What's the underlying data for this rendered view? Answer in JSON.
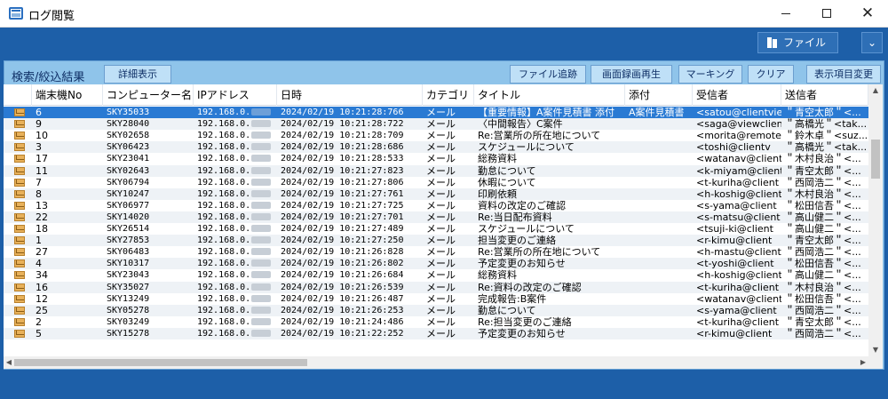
{
  "window": {
    "title": "ログ閲覧"
  },
  "toolbar": {
    "file_label": "ファイル",
    "dropdown_glyph": "⌄"
  },
  "panel": {
    "title": "検索/絞込結果",
    "buttons": {
      "detail": "詳細表示",
      "file_trace": "ファイル追跡",
      "screen_record": "画面録画再生",
      "marking": "マーキング",
      "clear": "クリア",
      "columns": "表示項目変更"
    }
  },
  "table": {
    "headers": [
      "端末機No",
      "コンピューター名",
      "IPアドレス",
      "日時",
      "カテゴリ",
      "タイトル",
      "添付",
      "受信者",
      "送信者"
    ],
    "ip_prefix": "192.168.0.",
    "rows": [
      {
        "no": "6",
        "pc": "SKY35033",
        "dt": "2024/02/19 10:21:28:766",
        "cat": "メール",
        "title": "【重要情報】A案件見積書 添付",
        "att": "A案件見積書",
        "to": "<satou@clientvie...",
        "from": "＂青空太郎＂<..."
      },
      {
        "no": "9",
        "pc": "SKY28040",
        "dt": "2024/02/19 10:21:28:722",
        "cat": "メール",
        "title": "〈中間報告〉C案件",
        "att": "",
        "to": "<saga@viewclient...",
        "from": "＂高橋光＂<tak..."
      },
      {
        "no": "10",
        "pc": "SKY02658",
        "dt": "2024/02/19 10:21:28:709",
        "cat": "メール",
        "title": "Re:営業所の所在地について",
        "att": "",
        "to": "<morita@remote...",
        "from": "＂鈴木卓＂<suz..."
      },
      {
        "no": "3",
        "pc": "SKY06423",
        "dt": "2024/02/19 10:21:28:686",
        "cat": "メール",
        "title": "スケジュールについて",
        "att": "",
        "to": "<toshi@clientv",
        "from": "＂高橋光＂<tak..."
      },
      {
        "no": "17",
        "pc": "SKY23041",
        "dt": "2024/02/19 10:21:28:533",
        "cat": "メール",
        "title": "総務資料",
        "att": "",
        "to": "<watanav@client",
        "from": "＂木村良治＂<..."
      },
      {
        "no": "11",
        "pc": "SKY02643",
        "dt": "2024/02/19 10:21:27:823",
        "cat": "メール",
        "title": "勤怠について",
        "att": "",
        "to": "<k-miyam@client",
        "from": "＂青空太郎＂<..."
      },
      {
        "no": "7",
        "pc": "SKY06794",
        "dt": "2024/02/19 10:21:27:806",
        "cat": "メール",
        "title": "休暇について",
        "att": "",
        "to": "<t-kuriha@client",
        "from": "＂西岡浩二＂<..."
      },
      {
        "no": "8",
        "pc": "SKY10247",
        "dt": "2024/02/19 10:21:27:761",
        "cat": "メール",
        "title": "印刷依頼",
        "att": "",
        "to": "<h-koshig@client",
        "from": "＂木村良治＂<..."
      },
      {
        "no": "13",
        "pc": "SKY06977",
        "dt": "2024/02/19 10:21:27:725",
        "cat": "メール",
        "title": "資料の改定のご確認",
        "att": "",
        "to": "<s-yama@client",
        "from": "＂松田信吾＂<..."
      },
      {
        "no": "22",
        "pc": "SKY14020",
        "dt": "2024/02/19 10:21:27:701",
        "cat": "メール",
        "title": "Re:当日配布資料",
        "att": "",
        "to": "<s-matsu@client",
        "from": "＂高山健二＂<..."
      },
      {
        "no": "18",
        "pc": "SKY26514",
        "dt": "2024/02/19 10:21:27:489",
        "cat": "メール",
        "title": "スケジュールについて",
        "att": "",
        "to": "<tsuji-ki@client",
        "from": "＂高山健二＂<..."
      },
      {
        "no": "1",
        "pc": "SKY27853",
        "dt": "2024/02/19 10:21:27:250",
        "cat": "メール",
        "title": "担当変更のご連絡",
        "att": "",
        "to": "<r-kimu@client",
        "from": "＂青空太郎＂<..."
      },
      {
        "no": "27",
        "pc": "SKY06483",
        "dt": "2024/02/19 10:21:26:828",
        "cat": "メール",
        "title": "Re:営業所の所在地について",
        "att": "",
        "to": "<h-mastu@client",
        "from": "＂西岡浩二＂<..."
      },
      {
        "no": "4",
        "pc": "SKY10317",
        "dt": "2024/02/19 10:21:26:802",
        "cat": "メール",
        "title": "予定変更のお知らせ",
        "att": "",
        "to": "<t-yoshi@client",
        "from": "＂松田信吾＂<..."
      },
      {
        "no": "34",
        "pc": "SKY23043",
        "dt": "2024/02/19 10:21:26:684",
        "cat": "メール",
        "title": "総務資料",
        "att": "",
        "to": "<h-koshig@client",
        "from": "＂高山健二＂<..."
      },
      {
        "no": "16",
        "pc": "SKY35027",
        "dt": "2024/02/19 10:21:26:539",
        "cat": "メール",
        "title": "Re:資料の改定のご確認",
        "att": "",
        "to": "<t-kuriha@client",
        "from": "＂木村良治＂<..."
      },
      {
        "no": "12",
        "pc": "SKY13249",
        "dt": "2024/02/19 10:21:26:487",
        "cat": "メール",
        "title": "完成報告:B案件",
        "att": "",
        "to": "<watanav@client",
        "from": "＂松田信吾＂<..."
      },
      {
        "no": "25",
        "pc": "SKY05278",
        "dt": "2024/02/19 10:21:26:253",
        "cat": "メール",
        "title": "勤怠について",
        "att": "",
        "to": "<s-yama@client",
        "from": "＂西岡浩二＂<..."
      },
      {
        "no": "2",
        "pc": "SKY03249",
        "dt": "2024/02/19 10:21:24:486",
        "cat": "メール",
        "title": "Re:担当変更のご連絡",
        "att": "",
        "to": "<t-kuriha@client",
        "from": "＂青空太郎＂<..."
      },
      {
        "no": "5",
        "pc": "SKY15278",
        "dt": "2024/02/19 10:21:22:252",
        "cat": "メール",
        "title": "予定変更のお知らせ",
        "att": "",
        "to": "<r-kimu@client",
        "from": "＂西岡浩二＂<..."
      }
    ]
  }
}
